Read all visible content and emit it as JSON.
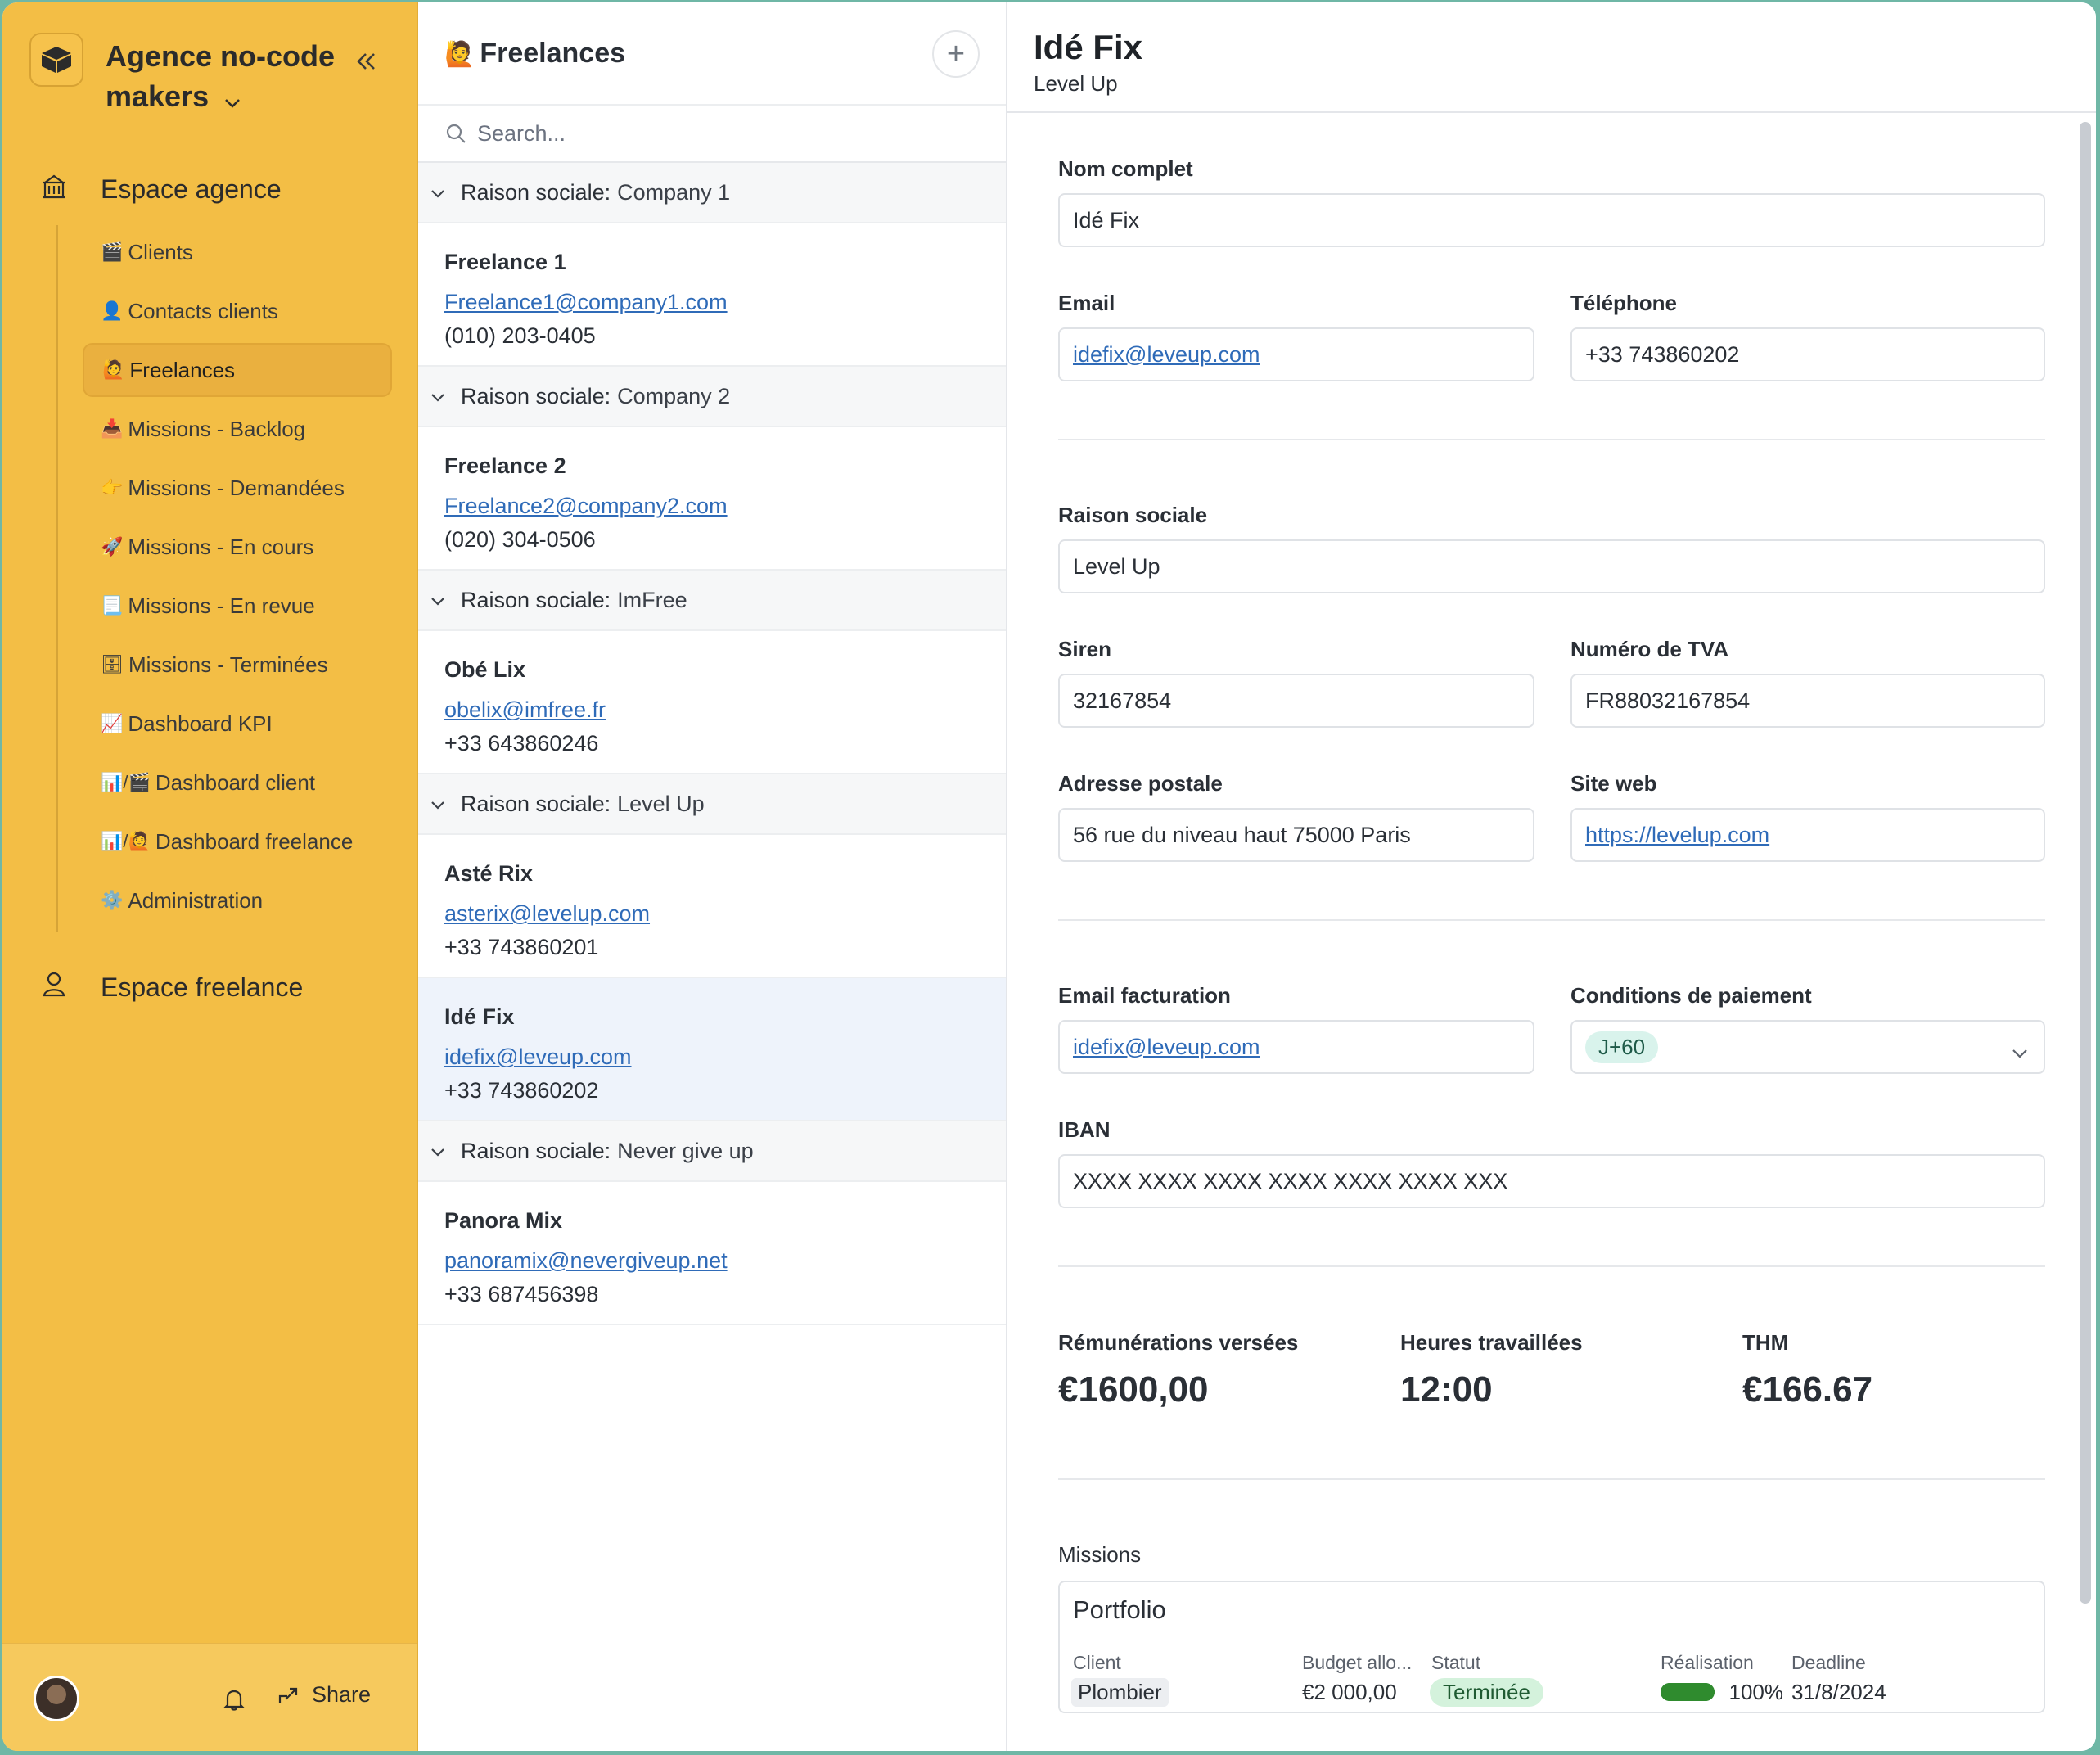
{
  "sidebar": {
    "org_name": "Agence no-code makers",
    "sections": {
      "agency": "Espace agence",
      "freelance": "Espace freelance"
    },
    "items": [
      {
        "emoji": "🎬",
        "label": "Clients"
      },
      {
        "emoji": "👤",
        "label": "Contacts clients"
      },
      {
        "emoji": "🙋",
        "label": "Freelances",
        "active": true
      },
      {
        "emoji": "📥",
        "label": "Missions - Backlog"
      },
      {
        "emoji": "👉",
        "label": "Missions - Demandées"
      },
      {
        "emoji": "🚀",
        "label": "Missions - En cours"
      },
      {
        "emoji": "📃",
        "label": "Missions - En revue"
      },
      {
        "emoji": "🗄",
        "label": "Missions - Terminées"
      },
      {
        "emoji": "📈",
        "label": "Dashboard KPI"
      },
      {
        "emoji": "📊/🎬",
        "label": "Dashboard client"
      },
      {
        "emoji": "📊/🙋",
        "label": "Dashboard freelance"
      },
      {
        "emoji": "⚙️",
        "label": "Administration"
      }
    ],
    "footer": {
      "share_label": "Share"
    }
  },
  "list": {
    "title": "Freelances",
    "title_emoji": "🙋",
    "add_label": "+",
    "search_placeholder": "Search...",
    "group_key": "Raison sociale:",
    "groups": [
      {
        "value": "Company 1",
        "items": [
          {
            "name": "Freelance 1",
            "email": "Freelance1@company1.com",
            "phone": "(010) 203-0405"
          }
        ]
      },
      {
        "value": "Company 2",
        "items": [
          {
            "name": "Freelance 2",
            "email": "Freelance2@company2.com",
            "phone": "(020) 304-0506"
          }
        ]
      },
      {
        "value": "ImFree",
        "items": [
          {
            "name": "Obé Lix",
            "email": "obelix@imfree.fr",
            "phone": "+33 643860246"
          }
        ]
      },
      {
        "value": "Level Up",
        "items": [
          {
            "name": "Asté Rix",
            "email": "asterix@levelup.com",
            "phone": "+33 743860201"
          },
          {
            "name": "Idé Fix",
            "email": "idefix@leveup.com",
            "phone": "+33 743860202",
            "selected": true
          }
        ]
      },
      {
        "value": "Never give up",
        "items": [
          {
            "name": "Panora Mix",
            "email": "panoramix@nevergiveup.net",
            "phone": "+33 687456398"
          }
        ]
      }
    ]
  },
  "detail": {
    "title": "Idé Fix",
    "subtitle": "Level Up",
    "labels": {
      "full_name": "Nom complet",
      "email": "Email",
      "phone": "Téléphone",
      "company": "Raison sociale",
      "siren": "Siren",
      "vat": "Numéro de TVA",
      "address": "Adresse postale",
      "website": "Site web",
      "billing_email": "Email facturation",
      "payment_terms": "Conditions de paiement",
      "iban": "IBAN",
      "paid": "Rémunérations versées",
      "hours": "Heures travaillées",
      "thm": "THM",
      "missions": "Missions"
    },
    "values": {
      "full_name": "Idé Fix",
      "email": "idefix@leveup.com",
      "phone": "+33 743860202",
      "company": "Level Up",
      "siren": "32167854",
      "vat": "FR88032167854",
      "address": "56 rue du niveau haut 75000 Paris",
      "website": "https://levelup.com",
      "billing_email": "idefix@leveup.com",
      "payment_terms": "J+60",
      "iban": "XXXX XXXX XXXX XXXX XXXX XXXX XXX",
      "paid": "€1600,00",
      "hours": "12:00",
      "thm": "€166.67"
    },
    "mission": {
      "title": "Portfolio",
      "headers": {
        "client": "Client",
        "budget": "Budget allo...",
        "status": "Statut",
        "progress": "Réalisation",
        "deadline": "Deadline"
      },
      "client": "Plombier",
      "budget": "€2 000,00",
      "status": "Terminée",
      "progress_text": "100%",
      "progress_fraction": 1.0,
      "deadline": "31/8/2024"
    }
  }
}
